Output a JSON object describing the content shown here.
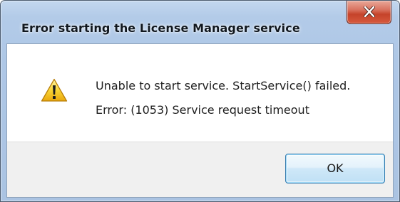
{
  "window": {
    "title": "Error starting the License Manager service",
    "close_icon": "close-x-icon"
  },
  "message": {
    "icon": "warning-icon",
    "line1": "Unable to start service. StartService() failed.",
    "line2": "Error: (1053) Service request timeout"
  },
  "buttons": {
    "ok_label": "OK"
  },
  "colors": {
    "close_button": "#c5432a",
    "warning_yellow": "#f5c518",
    "title_bar": "#aec7e6"
  }
}
